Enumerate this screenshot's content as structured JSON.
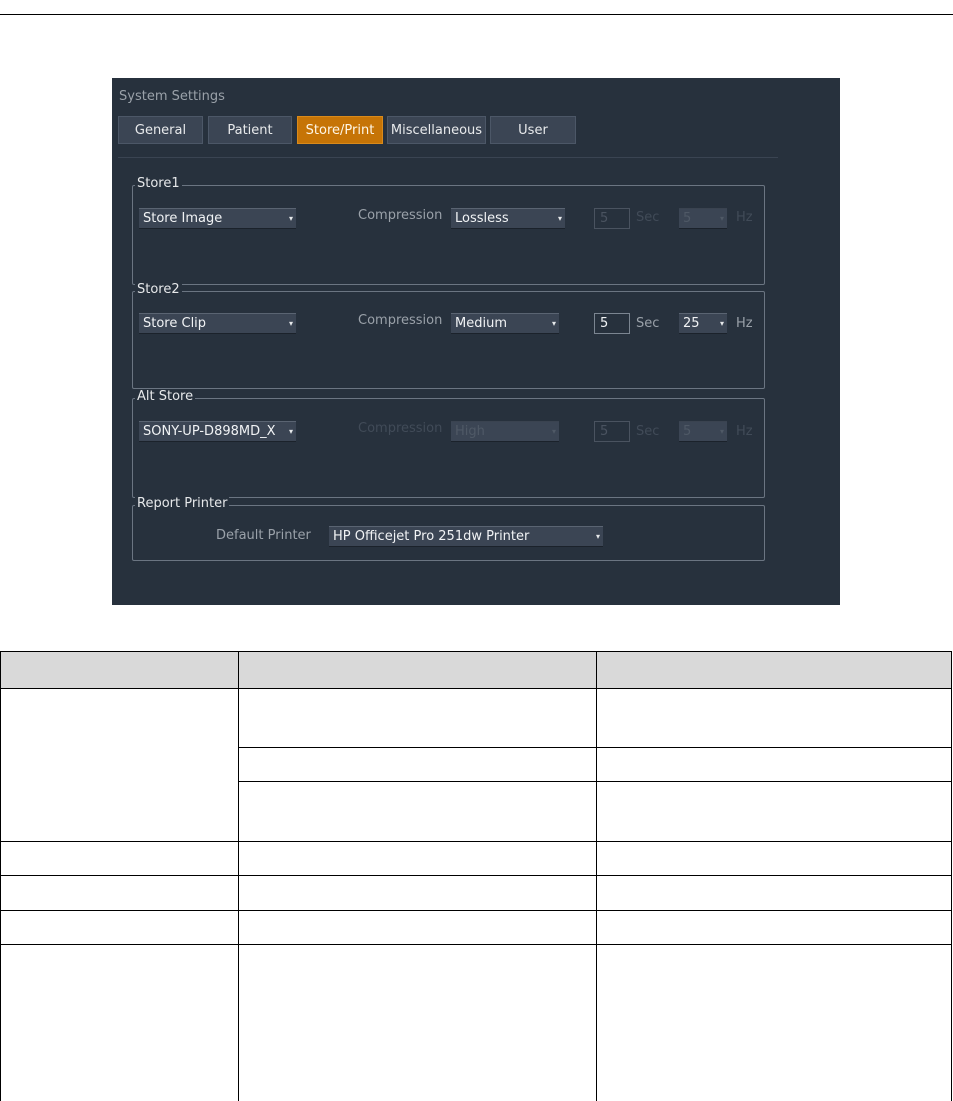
{
  "window": {
    "title": "System Settings"
  },
  "tabs": [
    {
      "label": "General",
      "active": false
    },
    {
      "label": "Patient",
      "active": false
    },
    {
      "label": "Store/Print",
      "active": true
    },
    {
      "label": "Miscellaneous",
      "active": false
    },
    {
      "label": "User",
      "active": false
    }
  ],
  "store1": {
    "title": "Store1",
    "mode": "Store Image",
    "compression_label": "Compression",
    "compression": "Lossless",
    "duration": "5",
    "duration_unit": "Sec",
    "rate": "5",
    "rate_unit": "Hz",
    "timing_enabled": false
  },
  "store2": {
    "title": "Store2",
    "mode": "Store Clip",
    "compression_label": "Compression",
    "compression": "Medium",
    "duration": "5",
    "duration_unit": "Sec",
    "rate": "25",
    "rate_unit": "Hz",
    "timing_enabled": true
  },
  "alt_store": {
    "title": "Alt Store",
    "mode": "SONY-UP-D898MD_X",
    "compression_label": "Compression",
    "compression": "High",
    "duration": "5",
    "duration_unit": "Sec",
    "rate": "5",
    "rate_unit": "Hz",
    "timing_enabled": false
  },
  "report_printer": {
    "title": "Report Printer",
    "default_label": "Default Printer",
    "printer": "HP Officejet Pro 251dw Printer"
  },
  "icons": {
    "dropdown": "dropdown-arrow-icon",
    "arrow_glyph": "▾"
  },
  "colors": {
    "accent": "#c67406",
    "panel_bg": "#27313d",
    "tab_bg": "#3b4554",
    "header_bg": "#d9d9d9"
  }
}
